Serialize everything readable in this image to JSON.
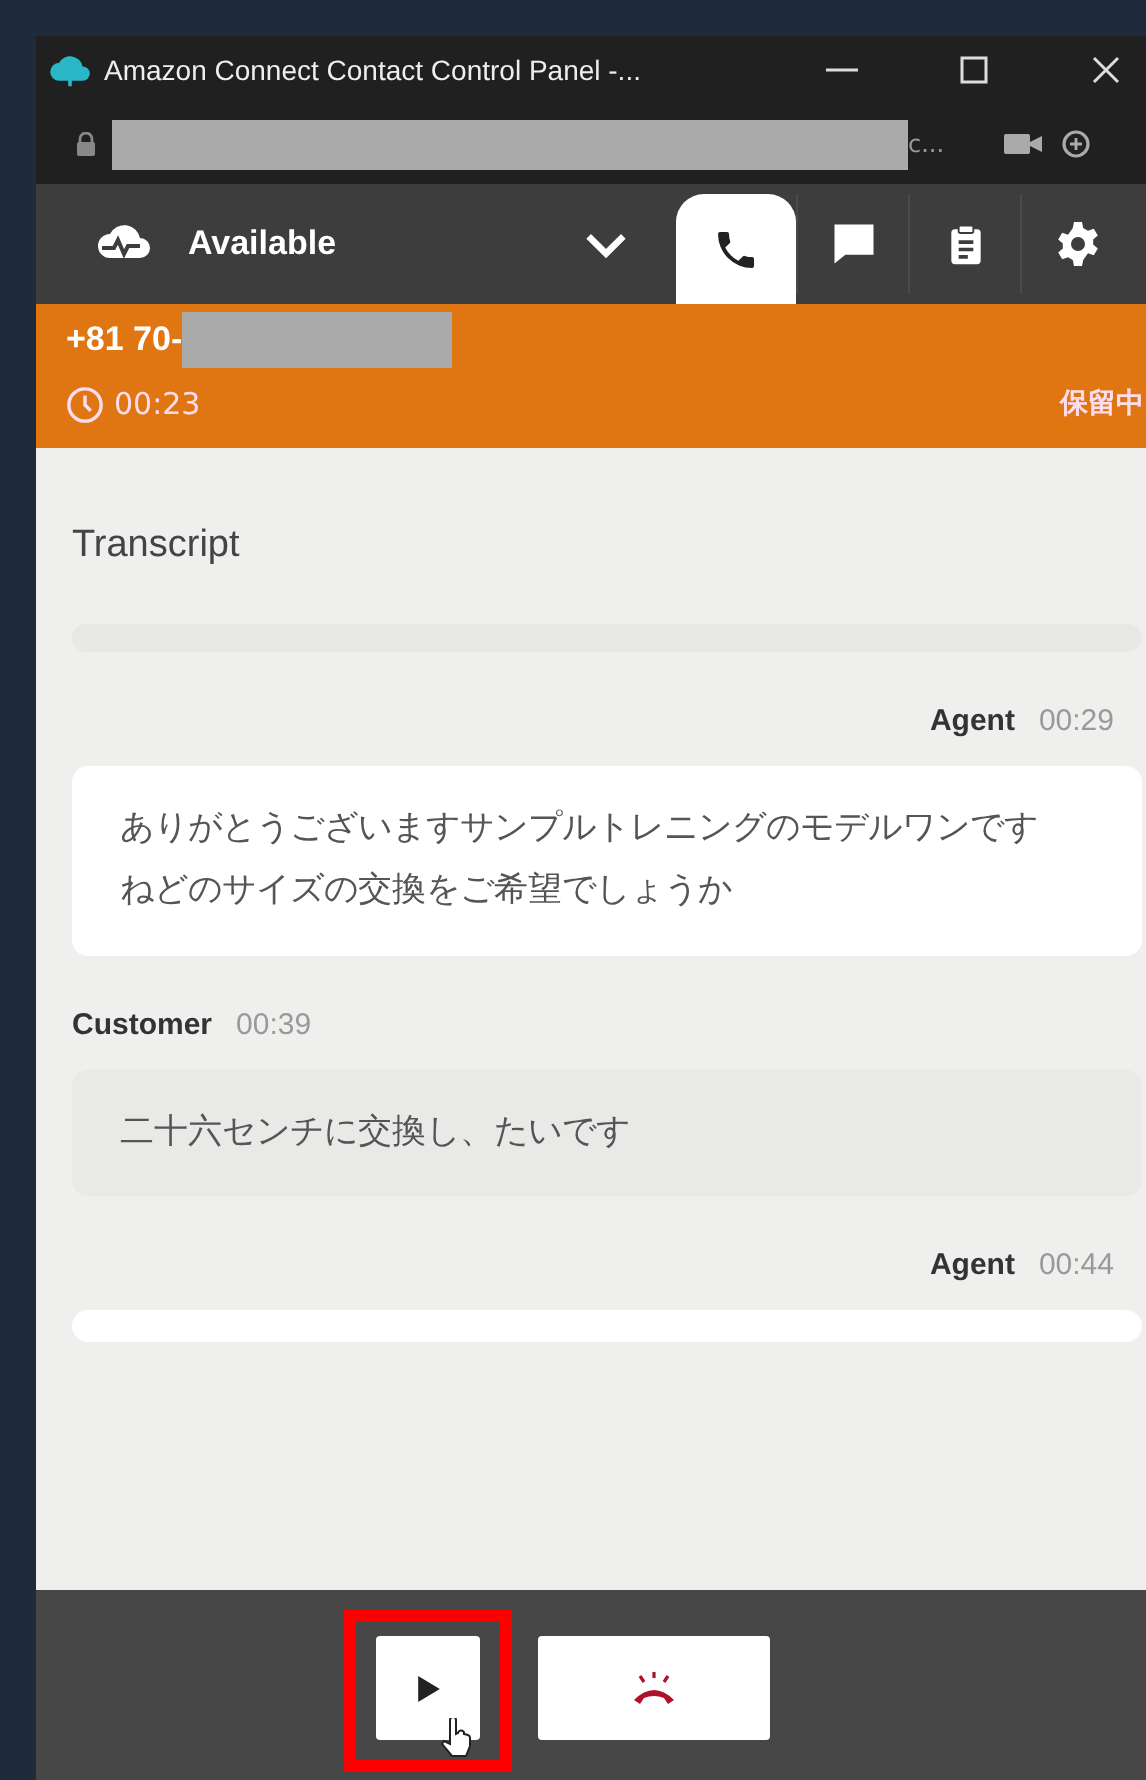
{
  "window": {
    "title": "Amazon Connect Contact Control Panel -...",
    "url_fragment": "c..."
  },
  "status": {
    "label": "Available"
  },
  "tabs": [
    {
      "kind": "phone",
      "selected": true
    },
    {
      "kind": "chat",
      "selected": false
    },
    {
      "kind": "tasks",
      "selected": false
    },
    {
      "kind": "settings",
      "selected": false
    }
  ],
  "contact": {
    "number": "+81 70-",
    "duration": "00:23",
    "state": "保留中"
  },
  "transcript": {
    "title": "Transcript",
    "messages": [
      {
        "kind": "placeholder"
      },
      {
        "kind": "agent",
        "speaker": "Agent",
        "time": "00:29",
        "text": "ありがとうございますサンプルトレニングのモデルワンですねどのサイズの交換をご希望でしょうか"
      },
      {
        "kind": "customer",
        "speaker": "Customer",
        "time": "00:39",
        "text": "二十六センチに交換し、たいです"
      },
      {
        "kind": "agent",
        "speaker": "Agent",
        "time": "00:44"
      }
    ]
  },
  "actions": [
    {
      "kind": "resume",
      "highlighted": true
    },
    {
      "kind": "hangup",
      "highlighted": false
    }
  ]
}
